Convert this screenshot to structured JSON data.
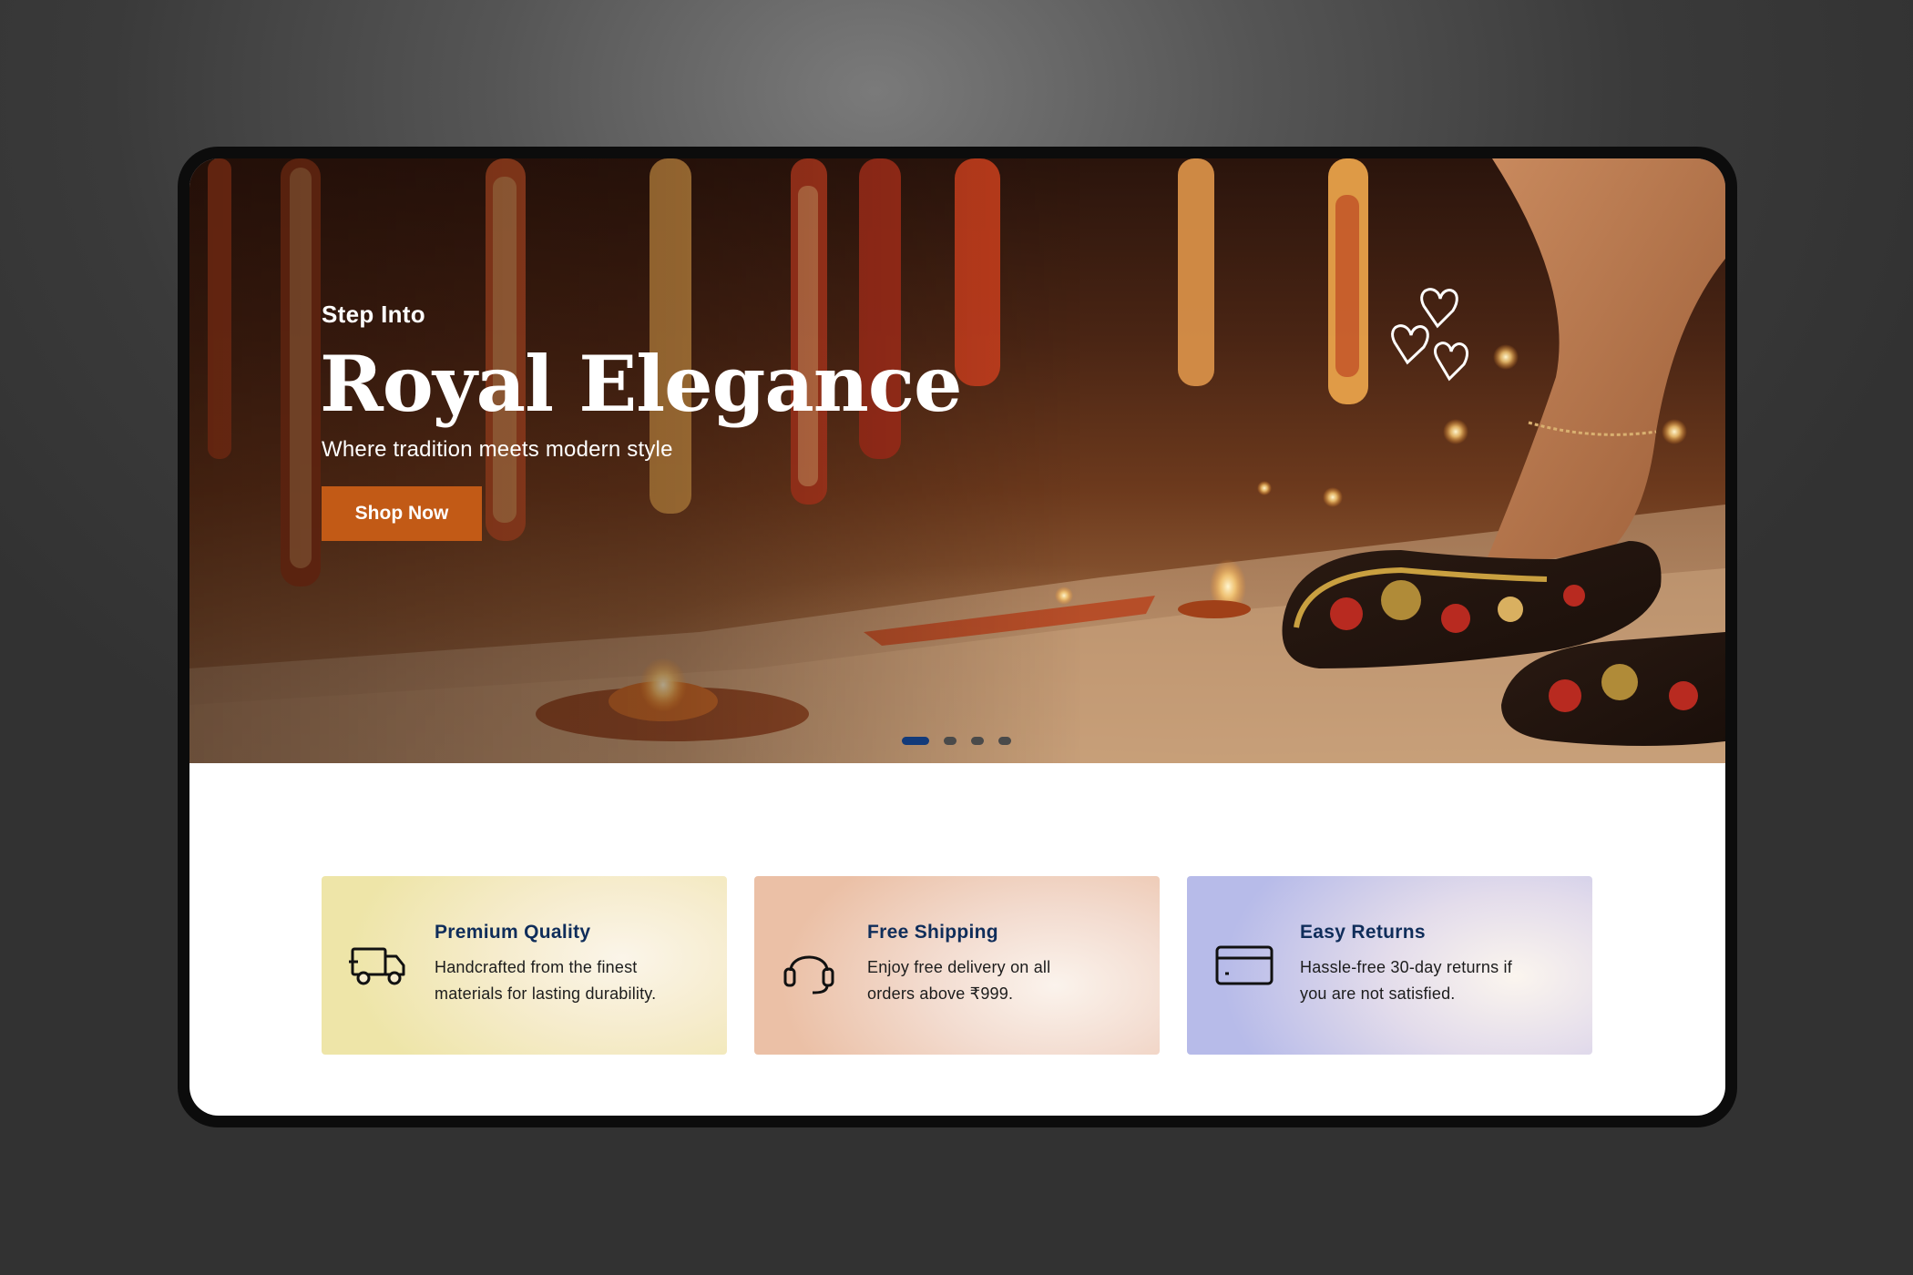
{
  "hero": {
    "eyebrow": "Step Into",
    "title": "Royal Elegance",
    "subtitle": "Where tradition meets modern style",
    "cta_label": "Shop Now",
    "slides_total": 4,
    "active_slide": 1
  },
  "features": [
    {
      "icon": "truck-icon",
      "title": "Premium Quality",
      "desc_line1": "Handcrafted from the finest",
      "desc_line2": "materials for lasting durability."
    },
    {
      "icon": "headset-icon",
      "title": "Free Shipping",
      "desc_line1": "Enjoy free delivery on all",
      "desc_line2": "orders above ₹999."
    },
    {
      "icon": "credit-card-icon",
      "title": "Easy Returns",
      "desc_line1": "Hassle-free 30-day returns if",
      "desc_line2": "you are not satisfied."
    }
  ],
  "colors": {
    "cta": "#c25a16",
    "feature_title": "#0f2d5a",
    "active_dot": "#123a7a"
  }
}
